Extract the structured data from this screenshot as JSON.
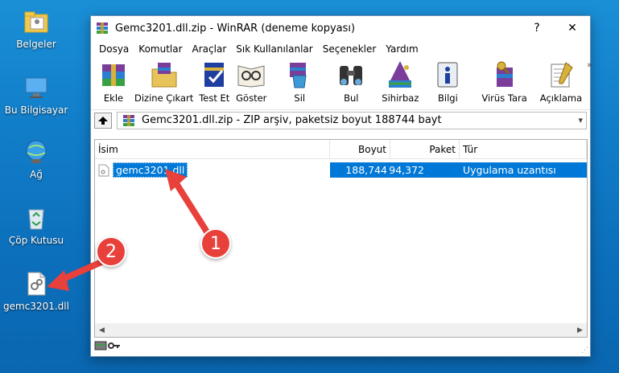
{
  "desktop": {
    "icons": [
      {
        "label": "Belgeler",
        "icon": "folder-icon"
      },
      {
        "label": "Bu Bilgisayar",
        "icon": "computer-icon"
      },
      {
        "label": "Ağ",
        "icon": "network-icon"
      },
      {
        "label": "Çöp Kutusu",
        "icon": "recycle-bin-icon"
      },
      {
        "label": "gemc3201.dll",
        "icon": "dll-file-icon"
      }
    ]
  },
  "window": {
    "title": "Gemc3201.dll.zip - WinRAR (deneme kopyası)",
    "help_label": "?",
    "close_label": "✕"
  },
  "menu": [
    "Dosya",
    "Komutlar",
    "Araçlar",
    "Sık Kullanılanlar",
    "Seçenekler",
    "Yardım"
  ],
  "toolbar": {
    "buttons": [
      {
        "label": "Ekle",
        "icon": "add-icon"
      },
      {
        "label": "Dizine Çıkart",
        "icon": "extract-icon"
      },
      {
        "label": "Test Et",
        "icon": "test-icon"
      },
      {
        "label": "Göster",
        "icon": "view-icon"
      },
      {
        "label": "Sil",
        "icon": "delete-icon"
      },
      {
        "label": "Bul",
        "icon": "find-icon"
      },
      {
        "label": "Sihirbaz",
        "icon": "wizard-icon"
      },
      {
        "label": "Bilgi",
        "icon": "info-icon"
      },
      {
        "label": "Virüs Tara",
        "icon": "virus-scan-icon"
      },
      {
        "label": "Açıklama",
        "icon": "comment-icon"
      }
    ],
    "more": "»"
  },
  "pathbar": {
    "text": "Gemc3201.dll.zip - ZIP arşiv, paketsiz boyut 188744 bayt"
  },
  "list": {
    "columns": {
      "name": "İsim",
      "size": "Boyut",
      "packed": "Paket",
      "type": "Tür"
    },
    "rows": [
      {
        "name": "gemc3201.dll",
        "size": "188,744",
        "packed": "94,372",
        "type": "Uygulama uzantısı"
      }
    ]
  },
  "annotations": {
    "badge1": "1",
    "badge2": "2"
  },
  "colors": {
    "selection": "#0078d7",
    "badge": "#e8403a",
    "desktop": "#117dc9"
  }
}
